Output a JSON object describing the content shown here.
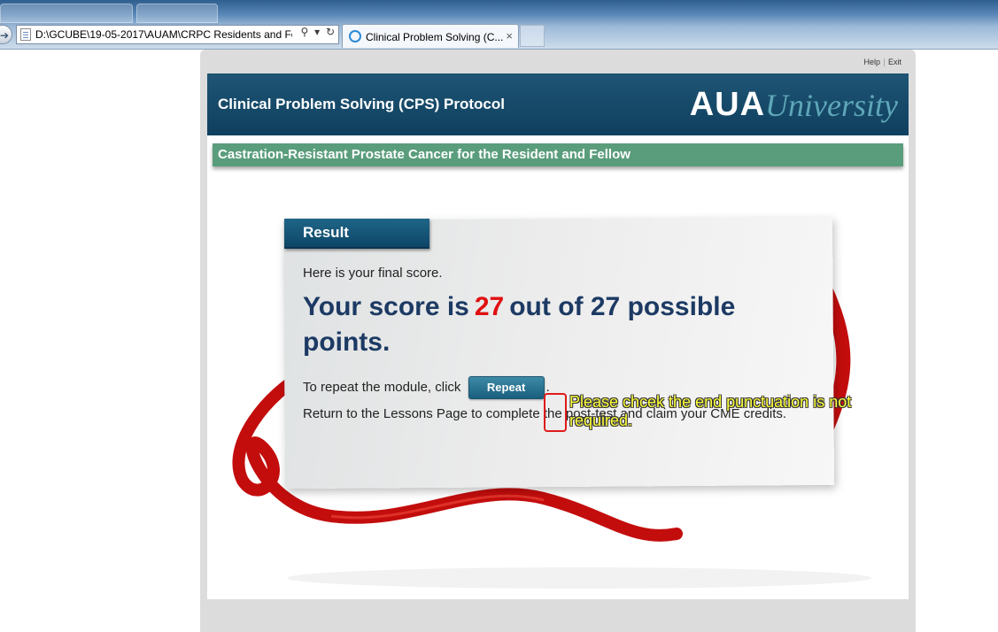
{
  "browser": {
    "address": "D:\\GCUBE\\19-05-2017\\AUAM\\CRPC Residents and Fel",
    "tab_title": "Clinical Problem Solving (C...",
    "tab_close": "×",
    "addr_tools": [
      "⚲",
      "▾",
      "↻"
    ]
  },
  "top_links": {
    "help": "Help",
    "exit": "Exit"
  },
  "header": {
    "title": "Clinical Problem Solving (CPS) Protocol",
    "logo_aua": "AUA",
    "logo_university": "University"
  },
  "subheader": {
    "title": "Castration-Resistant Prostate Cancer for the Resident and Fellow"
  },
  "result": {
    "tab_label": "Result",
    "intro": "Here is your final score.",
    "score_prefix": "Your score is",
    "score": "27",
    "score_suffix": "out of 27 possible points.",
    "repeat_text": "To repeat the module, click",
    "repeat_button": "Repeat",
    "repeat_period": ".",
    "return_text": "Return to the Lessons Page to complete the post-test and claim your CME credits."
  },
  "annotation": {
    "text": "Please chcek the end punctuation is not required.",
    "box_color": "#e01a1a",
    "text_color": "#ffff3a"
  },
  "colors": {
    "header_bg": "#174c6c",
    "subheader_bg": "#5a9d7c",
    "score_title": "#1c3a63",
    "score_value": "#e01010",
    "ribbon": "#d01010"
  }
}
